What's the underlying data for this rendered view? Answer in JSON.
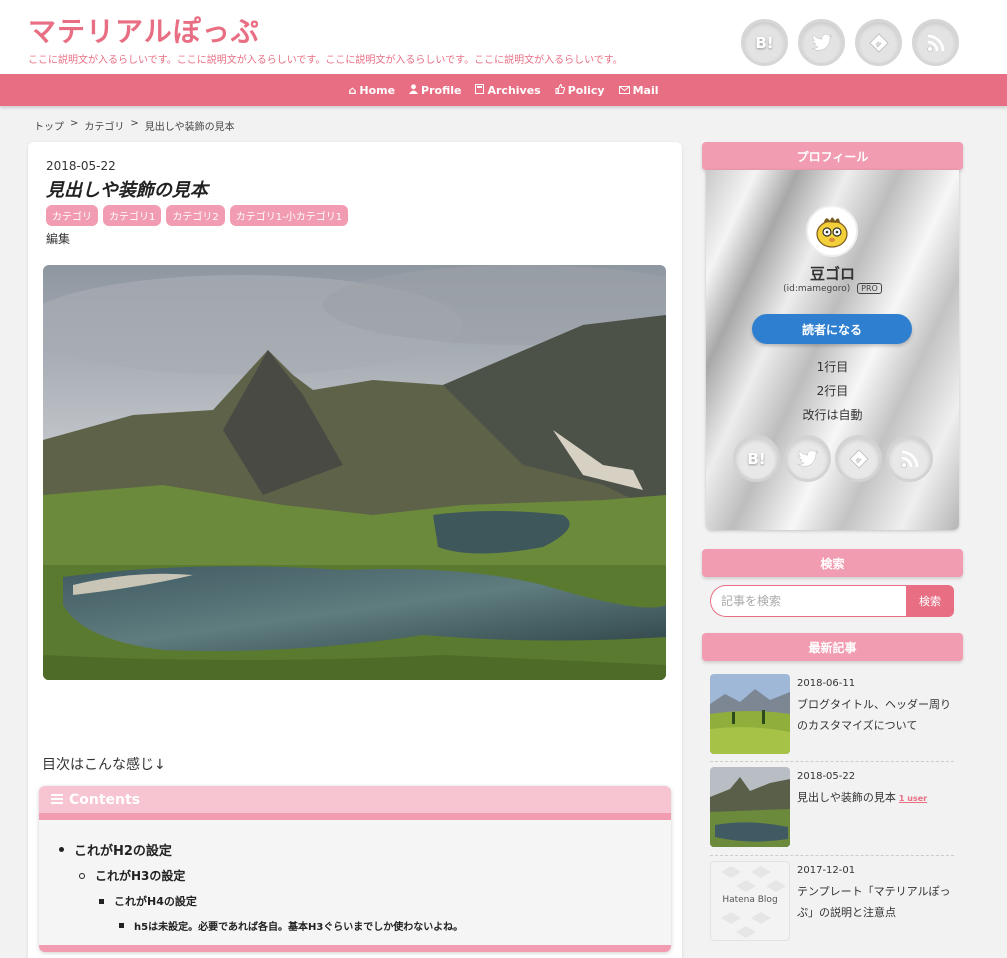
{
  "header": {
    "site_title": "マテリアルぽっぷ",
    "description": "ここに説明文が入るらしいです。ここに説明文が入るらしいです。ここに説明文が入るらしいです。ここに説明文が入るらしいです。",
    "social": [
      {
        "name": "hatena-bookmark-icon",
        "label": "B!"
      },
      {
        "name": "twitter-icon"
      },
      {
        "name": "feedly-icon"
      },
      {
        "name": "rss-icon"
      }
    ]
  },
  "nav": {
    "items": [
      {
        "label": "Home",
        "icon": "home-icon"
      },
      {
        "label": "Profile",
        "icon": "person-icon"
      },
      {
        "label": "Archives",
        "icon": "archive-icon"
      },
      {
        "label": "Policy",
        "icon": "thumbs-up-icon"
      },
      {
        "label": "Mail",
        "icon": "mail-icon"
      }
    ]
  },
  "breadcrumb": {
    "items": [
      "トップ",
      "カテゴリ",
      "見出しや装飾の見本"
    ],
    "separator": ">"
  },
  "post": {
    "date": "2018-05-22",
    "title": "見出しや装飾の見本",
    "categories": [
      "カテゴリ",
      "カテゴリ1",
      "カテゴリ2",
      "カテゴリ1-小カテゴリ1"
    ],
    "edit_label": "編集",
    "toc_intro": "目次はこんな感じ↓",
    "toc": {
      "title": "Contents",
      "items": [
        {
          "level": 2,
          "text": "これがH2の設定"
        },
        {
          "level": 3,
          "text": "これがH3の設定"
        },
        {
          "level": 4,
          "text": "これがH4の設定"
        },
        {
          "level": 5,
          "text": "h5は未設定。必要であれば各自。基本H3ぐらいまでしか使わないよね。"
        }
      ]
    }
  },
  "sidebar": {
    "profile": {
      "heading": "プロフィール",
      "name": "豆ゴロ",
      "id": "(id:mamegoro)",
      "badge": "PRO",
      "subscribe_label": "読者になる",
      "lines": [
        "1行目",
        "2行目",
        "改行は自動"
      ]
    },
    "search": {
      "heading": "検索",
      "placeholder": "記事を検索",
      "button_label": "検索"
    },
    "recent": {
      "heading": "最新記事",
      "items": [
        {
          "date": "2018-06-11",
          "title": "ブログタイトル、ヘッダー周りのカスタマイズについて"
        },
        {
          "date": "2018-05-22",
          "title": "見出しや装飾の見本",
          "badge": "1 user"
        },
        {
          "date": "2017-12-01",
          "title": "テンプレート「マテリアルぽっぷ」の説明と注意点",
          "thumb_text": "Hatena Blog"
        }
      ]
    }
  },
  "colors": {
    "accent": "#e86f83",
    "accent_light": "#f19cb0",
    "subscribe": "#2e7fcf"
  }
}
